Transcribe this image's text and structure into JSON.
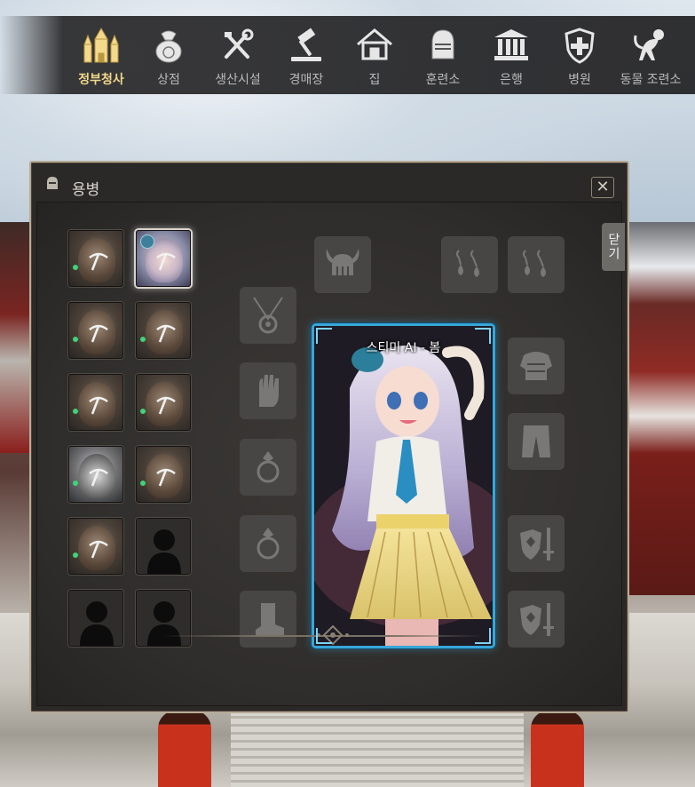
{
  "nav": {
    "items": [
      {
        "label": "정부청사",
        "icon": "castle-icon",
        "active": true
      },
      {
        "label": "상점",
        "icon": "money-bag-icon"
      },
      {
        "label": "생산시설",
        "icon": "tools-icon"
      },
      {
        "label": "경매장",
        "icon": "gavel-icon"
      },
      {
        "label": "집",
        "icon": "house-icon"
      },
      {
        "label": "훈련소",
        "icon": "helmet-icon"
      },
      {
        "label": "은행",
        "icon": "bank-icon"
      },
      {
        "label": "병원",
        "icon": "hospital-shield-icon"
      },
      {
        "label": "동물 조련소",
        "icon": "monkey-icon"
      }
    ],
    "active_color": "#f0d789",
    "inactive_color": "#b9b9b9"
  },
  "window": {
    "title": "용병",
    "close_symbol": "✕",
    "side_close_label": "닫기"
  },
  "mercenaries": [
    {
      "type": "hero",
      "status": "online"
    },
    {
      "type": "girl",
      "status": "selected"
    },
    {
      "type": "hero",
      "status": "online"
    },
    {
      "type": "hero",
      "status": "online"
    },
    {
      "type": "hero",
      "status": "online"
    },
    {
      "type": "hero",
      "status": "online"
    },
    {
      "type": "grey",
      "status": "online"
    },
    {
      "type": "hero",
      "status": "online"
    },
    {
      "type": "hero",
      "status": "online"
    },
    {
      "type": "locked",
      "status": "locked"
    },
    {
      "type": "locked",
      "status": "locked"
    },
    {
      "type": "locked",
      "status": "locked"
    }
  ],
  "equipment": {
    "helmet": "viking-helmet-icon",
    "earring_left": "earring-icon",
    "earring_right": "earring-icon",
    "necklace": "necklace-icon",
    "gloves": "glove-icon",
    "ring_1": "ring-icon",
    "ring_2": "ring-icon",
    "boots": "boot-icon",
    "armor": "armor-icon",
    "pants": "pants-icon",
    "weapon_1": "shield-sword-icon",
    "weapon_2": "shield-sword-icon"
  },
  "card": {
    "name": "스티미 AI - 봄",
    "border_color": "#37a6d8"
  }
}
